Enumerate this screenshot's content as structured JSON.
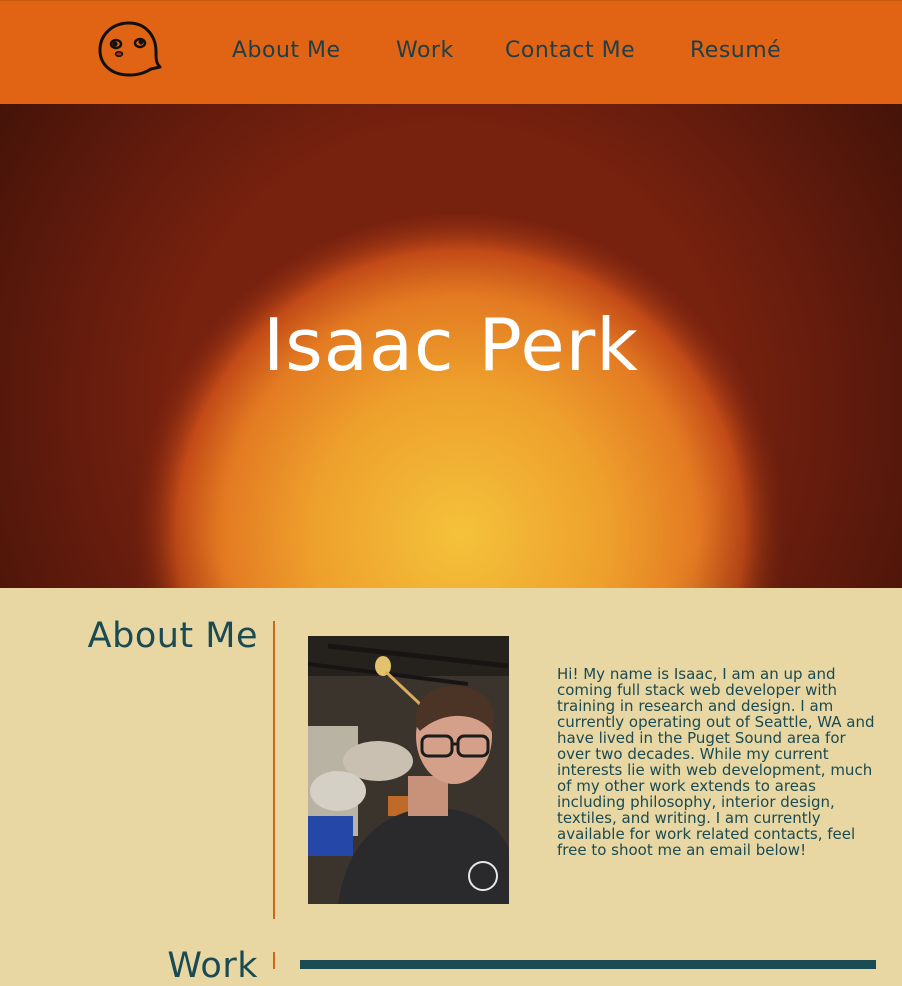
{
  "nav": {
    "items": [
      {
        "label": "About Me"
      },
      {
        "label": "Work"
      },
      {
        "label": "Contact Me"
      },
      {
        "label": "Resumé"
      }
    ]
  },
  "hero": {
    "title": "Isaac Perk"
  },
  "about": {
    "heading": "About Me",
    "text": "Hi! My name is Isaac, I am an up and coming full stack web developer with training in research and design. I am currently operating out of Seattle, WA and have lived in the Puget Sound area for over two decades. While my current interests lie with web development, much of my other work extends to areas including philosophy, interior design, textiles, and writing. I am currently available for work related contacts, feel free to shoot me an email below!"
  },
  "work": {
    "heading": "Work"
  },
  "colors": {
    "header_bg": "#e06414",
    "page_bg": "#e8d7a2",
    "heading_text": "#1a4a54",
    "accent": "#d0651c"
  }
}
